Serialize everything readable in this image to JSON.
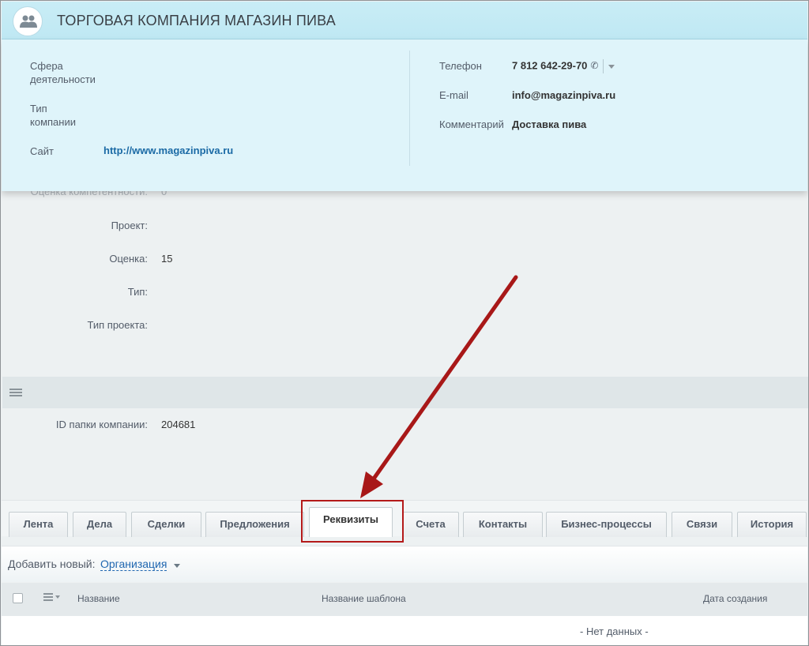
{
  "company": {
    "title": "ТОРГОВАЯ КОМПАНИЯ МАГАЗИН ПИВА"
  },
  "info_card": {
    "left": [
      {
        "label": "Сфера деятельности",
        "value": ""
      },
      {
        "label": "Тип компании",
        "value": ""
      },
      {
        "label": "Сайт",
        "value": "http://www.magazinpiva.ru"
      }
    ],
    "right": [
      {
        "label": "Телефон",
        "value": "7 812 642-29-70"
      },
      {
        "label": "E-mail",
        "value": "info@magazinpiva.ru"
      },
      {
        "label": "Комментарий",
        "value": "Доставка пива"
      }
    ]
  },
  "details": {
    "faded_label": "Оценка компетентности:",
    "faded_value": "0",
    "fields": [
      {
        "label": "Проект:",
        "value": ""
      },
      {
        "label": "Оценка:",
        "value": "15"
      },
      {
        "label": "Тип:",
        "value": ""
      },
      {
        "label": "Тип проекта:",
        "value": ""
      }
    ],
    "folder": {
      "label": "ID папки компании:",
      "value": "204681"
    }
  },
  "tabs": [
    {
      "label": "Лента"
    },
    {
      "label": "Дела"
    },
    {
      "label": "Сделки"
    },
    {
      "label": "Предложения"
    },
    {
      "label": "Реквизиты",
      "active": true
    },
    {
      "label": "Счета"
    },
    {
      "label": "Контакты"
    },
    {
      "label": "Бизнес-процессы"
    },
    {
      "label": "Связи"
    },
    {
      "label": "История"
    }
  ],
  "add_new": {
    "label": "Добавить новый:",
    "type": "Организация"
  },
  "grid": {
    "columns": [
      "Название",
      "Название шаблона",
      "Дата создания"
    ],
    "empty_text": "- Нет данных -"
  },
  "colors": {
    "accent": "#2067b0",
    "annotation": "#b41a1a",
    "header_bg": "#c9edf6"
  },
  "icons": [
    "company-avatar-icon",
    "phone-icon",
    "hamburger-icon",
    "dropdown-arrow-icon",
    "checkbox-icon",
    "column-menu-icon"
  ]
}
